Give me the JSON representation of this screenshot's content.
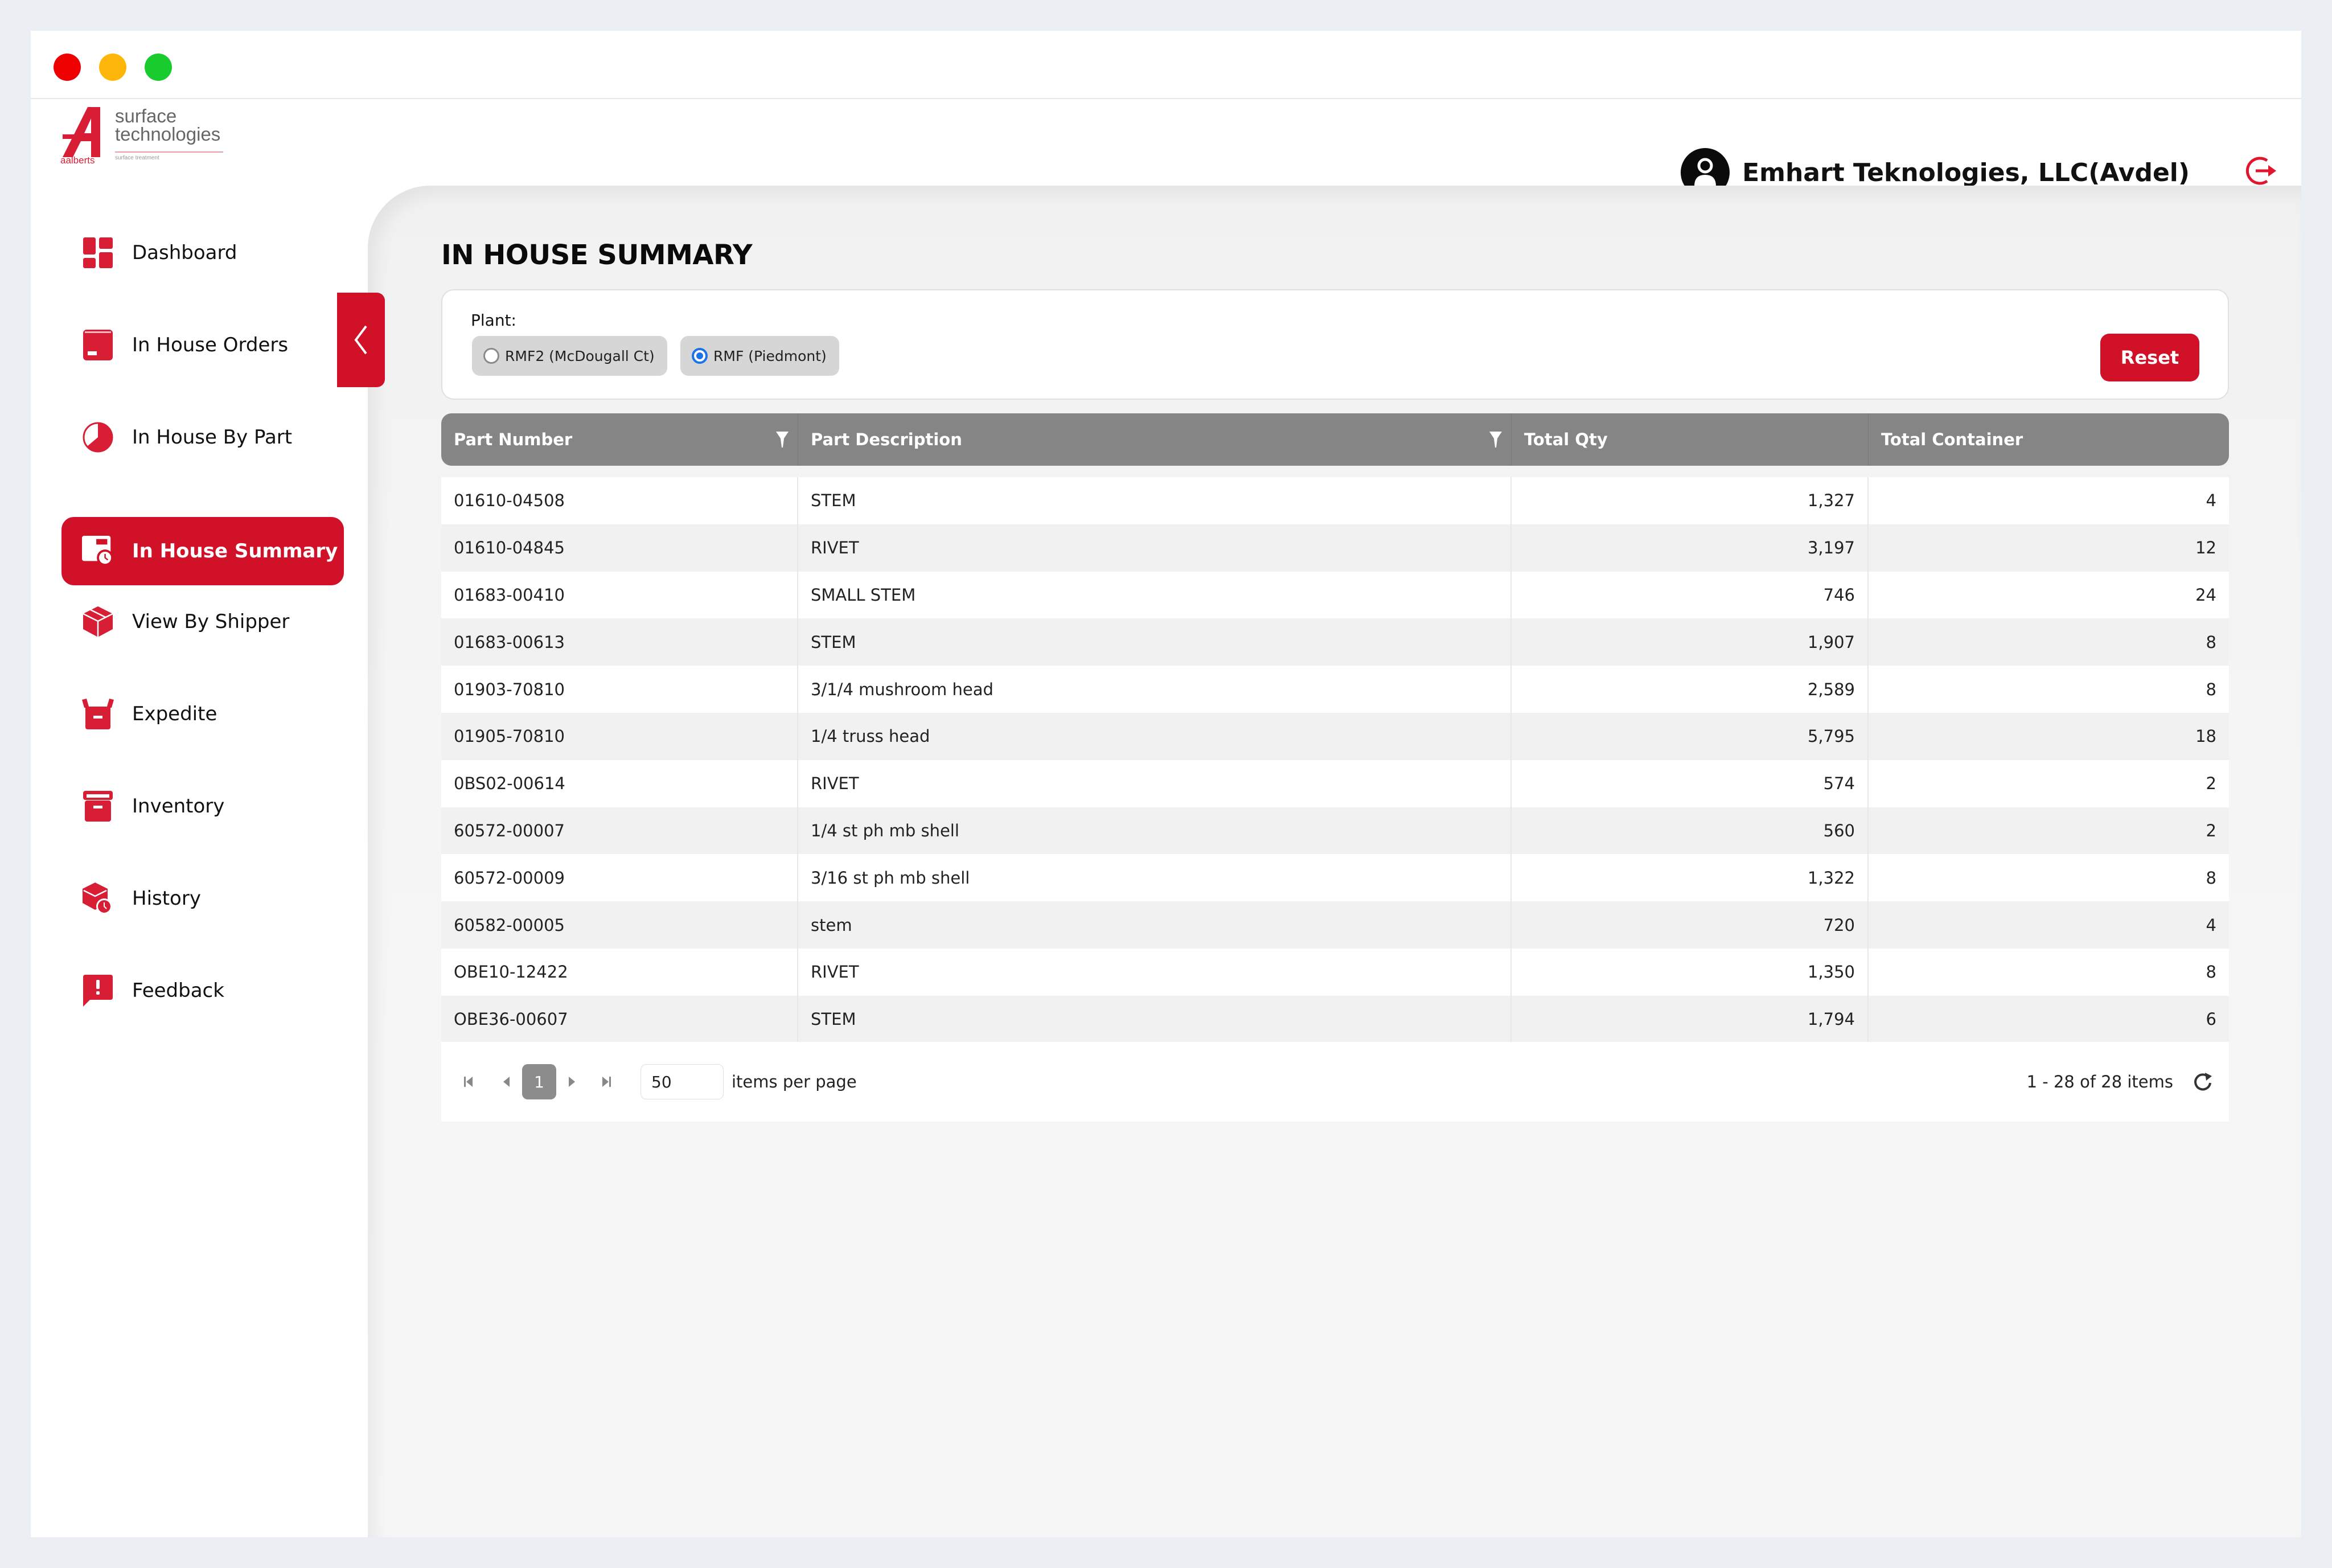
{
  "window": {
    "controls": [
      "close",
      "minimize",
      "maximize"
    ],
    "colors": {
      "close": "#ee0000",
      "minimize": "#ffb60a",
      "maximize": "#19cc2e"
    }
  },
  "brand": {
    "logo_mark": "A",
    "logo_company": "aalberts",
    "logo_line1": "surface",
    "logo_line2": "technologies",
    "logo_tagline": "surface treatment",
    "accent_color": "#d01128"
  },
  "header": {
    "user_icon": "user-icon",
    "user_name": "Emhart Teknologies, LLC(Avdel)",
    "logout_icon": "logout-icon"
  },
  "sidebar": {
    "items": [
      {
        "label": "Dashboard",
        "icon": "dashboard-icon",
        "active": false
      },
      {
        "label": "In House Orders",
        "icon": "orders-box-icon",
        "active": false
      },
      {
        "label": "In House By Part",
        "icon": "pie-chart-icon",
        "active": false
      },
      {
        "label": "In House Summary",
        "icon": "summary-clock-icon",
        "active": true
      },
      {
        "label": "View By Shipper",
        "icon": "package-icon",
        "active": false
      },
      {
        "label": "Expedite",
        "icon": "open-box-icon",
        "active": false
      },
      {
        "label": "Inventory",
        "icon": "archive-icon",
        "active": false
      },
      {
        "label": "History",
        "icon": "box-clock-icon",
        "active": false
      },
      {
        "label": "Feedback",
        "icon": "feedback-icon",
        "active": false
      }
    ],
    "collapse_icon": "chevron-left-icon"
  },
  "main": {
    "title": "IN HOUSE SUMMARY",
    "filter": {
      "label": "Plant:",
      "options": [
        {
          "label": "RMF2 (McDougall Ct)",
          "selected": false
        },
        {
          "label": "RMF (Piedmont)",
          "selected": true
        }
      ],
      "reset_label": "Reset"
    },
    "table": {
      "columns": [
        {
          "label": "Part Number",
          "filterable": true
        },
        {
          "label": "Part Description",
          "filterable": true
        },
        {
          "label": "Total Qty",
          "filterable": false
        },
        {
          "label": "Total Container",
          "filterable": false
        }
      ],
      "rows": [
        [
          "01610-04508",
          "STEM",
          "1,327",
          "4"
        ],
        [
          "01610-04845",
          "RIVET",
          "3,197",
          "12"
        ],
        [
          "01683-00410",
          "SMALL STEM",
          "746",
          "24"
        ],
        [
          "01683-00613",
          "STEM",
          "1,907",
          "8"
        ],
        [
          "01903-70810",
          "3/1/4 mushroom head",
          "2,589",
          "8"
        ],
        [
          "01905-70810",
          "1/4 truss head",
          "5,795",
          "18"
        ],
        [
          "0BS02-00614",
          "RIVET",
          "574",
          "2"
        ],
        [
          "60572-00007",
          "1/4 st ph mb shell",
          "560",
          "2"
        ],
        [
          "60572-00009",
          "3/16 st ph mb shell",
          "1,322",
          "8"
        ],
        [
          "60582-00005",
          "stem",
          "720",
          "4"
        ],
        [
          "OBE10-12422",
          "RIVET",
          "1,350",
          "8"
        ],
        [
          "OBE36-00607",
          "STEM",
          "1,794",
          "6"
        ]
      ]
    },
    "pager": {
      "current_page": "1",
      "page_size": "50",
      "page_size_label": "items per page",
      "info": "1 - 28 of 28 items"
    }
  }
}
